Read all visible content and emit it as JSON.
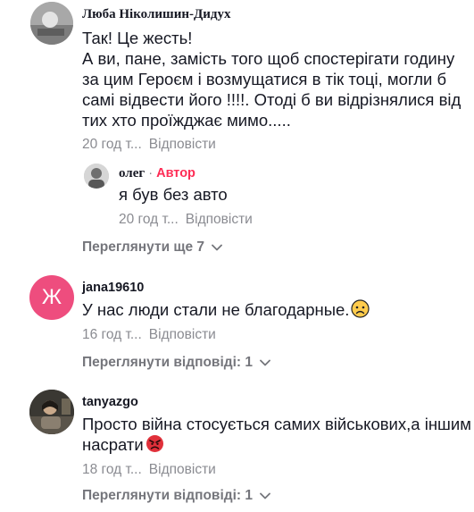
{
  "comments": [
    {
      "username": "Люба Ніколишин-Дидух",
      "text_lines": [
        "Так! Це жесть!",
        "А ви, пане, замість того щоб спостерігати годину",
        "за цим Героєм і возмущатися в тік тоці, могли б",
        "самі відвести його !!!!. Отоді б ви відрізнялися від",
        "тих хто проїжджає мимо....."
      ],
      "time": "20 год т...",
      "reply_label": "Відповісти",
      "reply": {
        "username": "олег",
        "separator": "·",
        "author_badge": "Автор",
        "text": "я був без авто",
        "time": "20 год т...",
        "reply_label": "Відповісти"
      },
      "view_more": "Переглянути ще 7"
    },
    {
      "username": "jana19610",
      "avatar_letter": "Ж",
      "avatar_color": "#ee4d7e",
      "text": "У нас люди стали не благодарные.",
      "emoji": "worried-face",
      "time": "16 год т...",
      "reply_label": "Відповісти",
      "view_more": "Переглянути відповіді: 1"
    },
    {
      "username": "tanyazgo",
      "text_lines": [
        "Просто війна стосується самих військових,а іншим",
        "насрати"
      ],
      "emoji": "angry-face",
      "time": "18 год т...",
      "reply_label": "Відповісти",
      "view_more": "Переглянути відповіді: 1"
    }
  ]
}
